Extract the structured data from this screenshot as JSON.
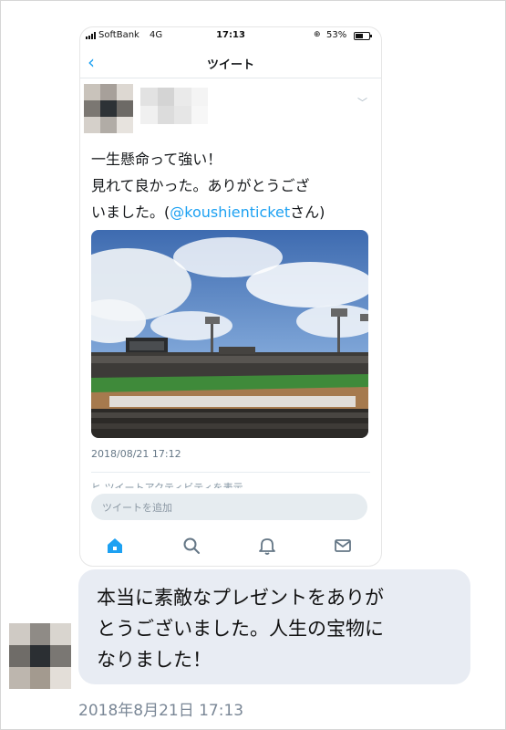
{
  "status_bar": {
    "carrier": "SoftBank",
    "network": "4G",
    "time": "17:13",
    "battery": "53%"
  },
  "nav": {
    "back_icon": "chevron-left-icon",
    "title": "ツイート"
  },
  "tweet": {
    "line1": "一生懸命って強い！",
    "line2": "見れて良かった。ありがとうござ",
    "line3_pre": "いました。(",
    "mention": "@koushienticket",
    "line3_post": "さん)",
    "date": "2018/08/21 17:12",
    "cut_off_line": "ヒ ツイートアクティビティを表示",
    "photo": "baseball-stadium-photo"
  },
  "reply": {
    "placeholder": "ツイートを追加"
  },
  "tabs": [
    {
      "icon": "home-icon"
    },
    {
      "icon": "search-icon"
    },
    {
      "icon": "bell-icon"
    },
    {
      "icon": "mail-icon"
    }
  ],
  "message": {
    "line1": "本当に素敵なプレゼントをありが",
    "line2": "とうございました。人生の宝物に",
    "line3": "なりました！",
    "timestamp": "2018年8月21日 17:13"
  },
  "colors": {
    "accent": "#1da1f2",
    "bubble": "#e8ecf3"
  }
}
